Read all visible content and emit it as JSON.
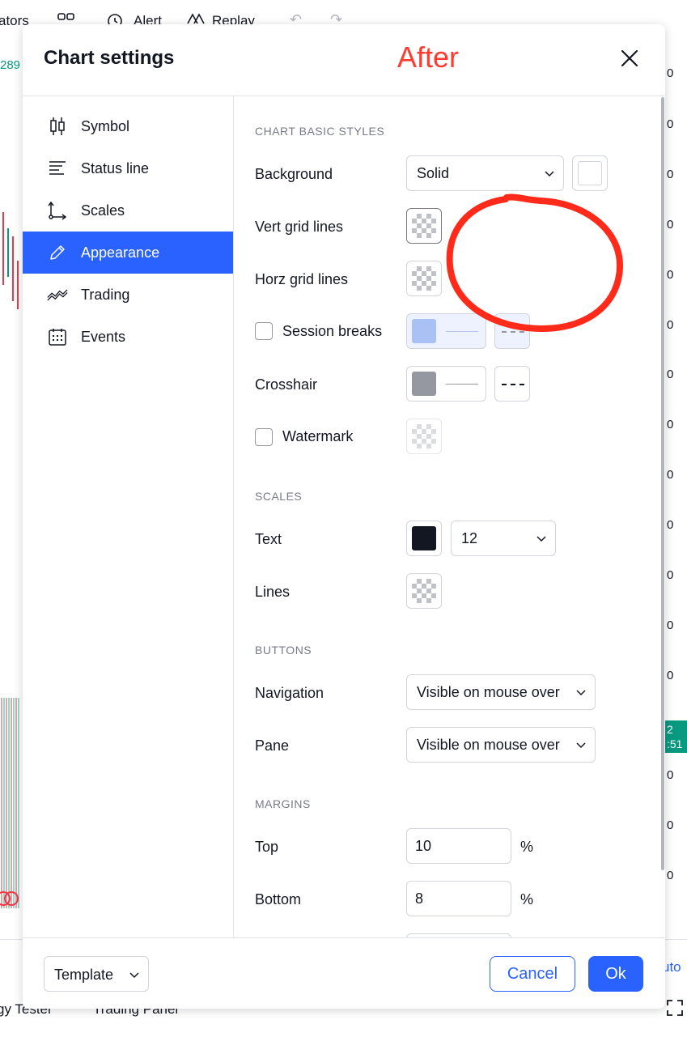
{
  "background_app": {
    "topbar": {
      "indicators_partial": "ators",
      "alert": "Alert",
      "replay": "Replay"
    },
    "left_price": "289",
    "axis_digit": "0",
    "price_tag": {
      "line1": "2",
      "line2": ":51"
    },
    "bottom": {
      "strategy_tester_partial": "gy Tester",
      "trading_panel_partial": "Trading Panel",
      "auto_partial": "uto"
    }
  },
  "annotation": {
    "label": "After",
    "color": "#ff3b30"
  },
  "dialog": {
    "title": "Chart settings",
    "sidebar": {
      "items": [
        {
          "label": "Symbol",
          "icon": "candlestick-icon"
        },
        {
          "label": "Status line",
          "icon": "status-line-icon"
        },
        {
          "label": "Scales",
          "icon": "scales-icon"
        },
        {
          "label": "Appearance",
          "icon": "pencil-icon",
          "active": true
        },
        {
          "label": "Trading",
          "icon": "trading-icon"
        },
        {
          "label": "Events",
          "icon": "calendar-icon"
        }
      ]
    },
    "sections": {
      "basic_styles": "CHART BASIC STYLES",
      "scales": "SCALES",
      "buttons": "BUTTONS",
      "margins": "MARGINS"
    },
    "rows": {
      "background": {
        "label": "Background",
        "value": "Solid"
      },
      "vert_grid": {
        "label": "Vert grid lines"
      },
      "horz_grid": {
        "label": "Horz grid lines"
      },
      "session_breaks": {
        "label": "Session breaks",
        "checked": false
      },
      "crosshair": {
        "label": "Crosshair"
      },
      "watermark": {
        "label": "Watermark",
        "checked": false
      },
      "text": {
        "label": "Text",
        "font_size": "12"
      },
      "lines": {
        "label": "Lines"
      },
      "navigation": {
        "label": "Navigation",
        "value": "Visible on mouse over"
      },
      "pane": {
        "label": "Pane",
        "value": "Visible on mouse over"
      },
      "top": {
        "label": "Top",
        "value": "10",
        "unit": "%"
      },
      "bottom": {
        "label": "Bottom",
        "value": "8",
        "unit": "%"
      }
    },
    "colors": {
      "accent": "#2962ff",
      "session_color": "#a9c1f5",
      "crosshair_color": "#9598a1",
      "text_color": "#131722"
    },
    "footer": {
      "template": "Template",
      "cancel": "Cancel",
      "ok": "Ok"
    }
  }
}
